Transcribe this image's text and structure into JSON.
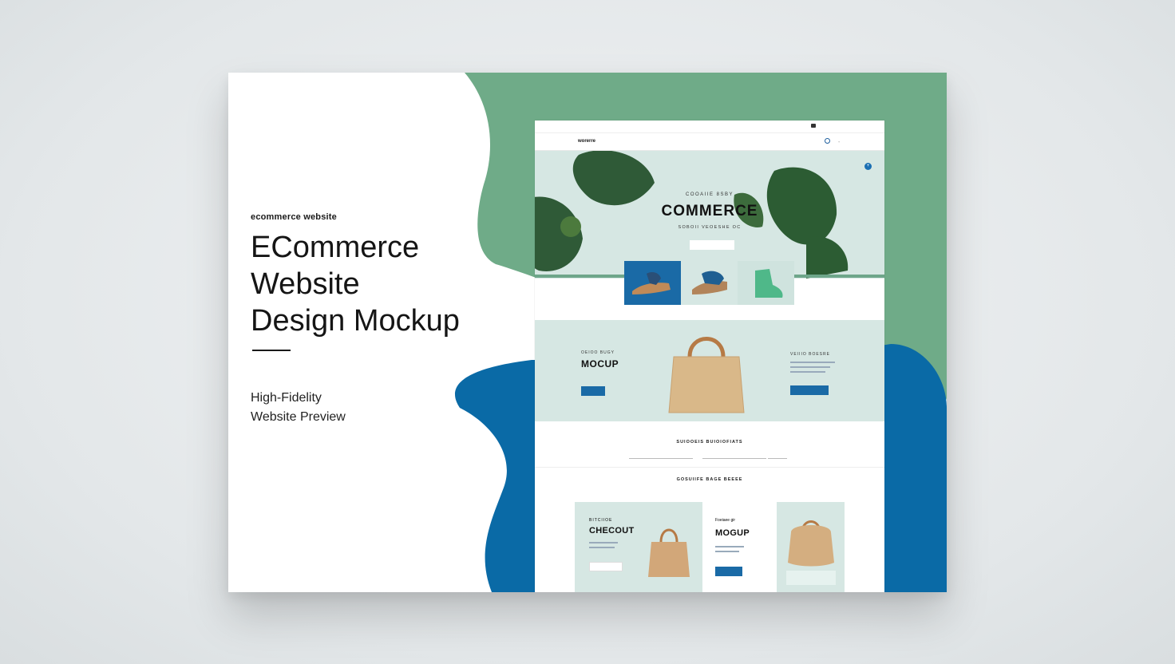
{
  "poster": {
    "kicker": "ecommerce website",
    "headline": [
      "ECommerce",
      "Website",
      "Design Mockup"
    ],
    "sub": [
      "High-Fidelity",
      "Website Preview"
    ]
  },
  "colors": {
    "green": "#6fab88",
    "blue": "#0a6aa6",
    "mint": "#d6e7e3",
    "ink": "#151515"
  },
  "site": {
    "topbar": {
      "left": [
        "",
        ""
      ],
      "right": [
        "",
        ""
      ]
    },
    "logo": "worerre",
    "nav": [
      "",
      "",
      "",
      "",
      ""
    ],
    "hero": {
      "eyebrow": "COOAIIE 8SBY",
      "title": "COMMERCE",
      "sub": "SOBOII VEOESHE OC",
      "cta": ""
    },
    "promo": {
      "eyebrow_left": "OEIOO BUGY",
      "title": "MOCUP",
      "cta_left": "",
      "eyebrow_right": "VEIIIO BOESRE",
      "cta_right": ""
    },
    "form_section": {
      "heading": "SUIOOEIS BUIOIOFIATS"
    },
    "products": {
      "heading": "GOSUIIFE BAGE BEEEE",
      "cards": [
        {
          "eyebrow": "BITCIIOE",
          "title": "CHECOUT",
          "cta": ""
        },
        {
          "eyebrow": "Foeiaee gir",
          "title": "MOGUP",
          "cta": ""
        }
      ]
    },
    "icons": [
      "search-icon",
      "cart-icon",
      "plus-icon"
    ]
  }
}
